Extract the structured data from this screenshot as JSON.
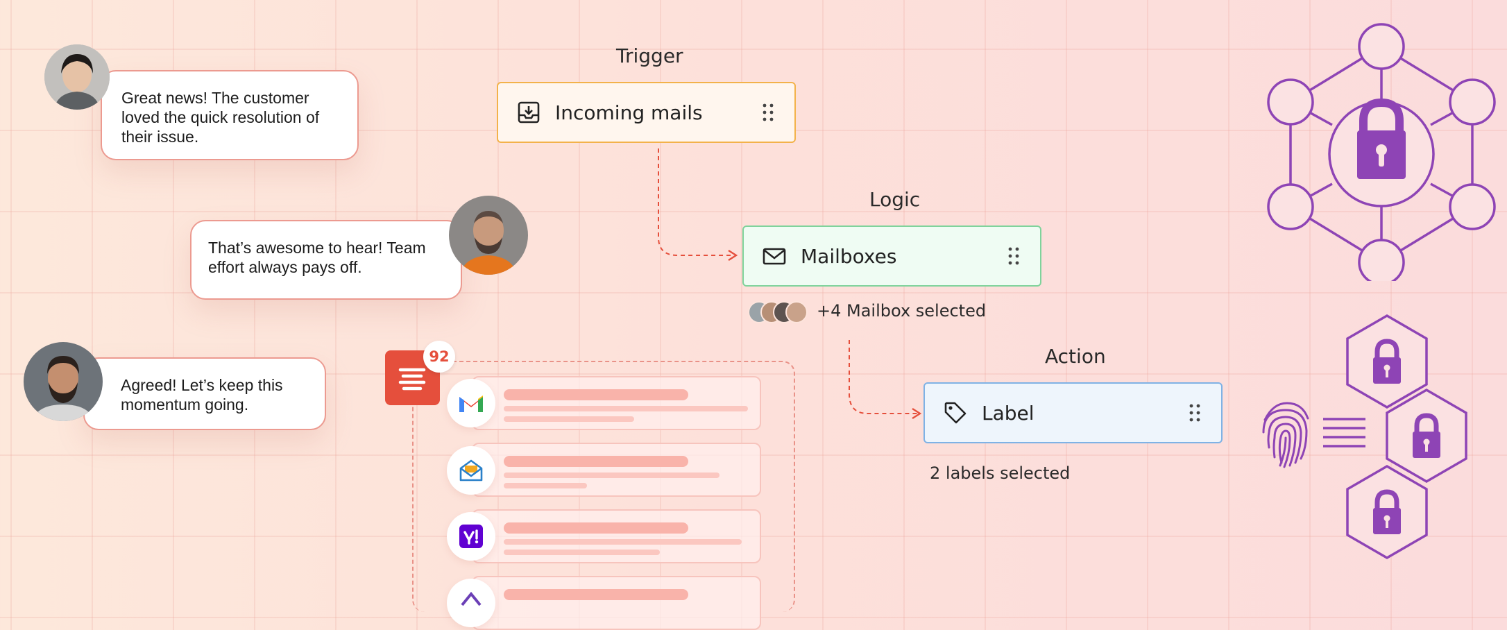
{
  "chat": {
    "messages": [
      {
        "text": "Great news! The customer loved the quick resolution of their issue."
      },
      {
        "text": "That’s awesome to hear! Team effort always pays off."
      },
      {
        "text": "Agreed! Let’s keep this momentum going."
      }
    ]
  },
  "workflow": {
    "trigger": {
      "title": "Trigger",
      "label": "Incoming mails"
    },
    "logic": {
      "title": "Logic",
      "label": "Mailboxes",
      "caption": "+4 Mailbox selected"
    },
    "action": {
      "title": "Action",
      "label": "Label",
      "caption": "2 labels selected"
    }
  },
  "inbox": {
    "badge_count": "92",
    "apps": [
      "gmail-icon",
      "zoho-mail-icon",
      "yahoo-icon",
      "outlook-icon"
    ]
  },
  "colors": {
    "accent_red": "#e54f3c",
    "security_purple": "#8e44b5",
    "trigger_border": "#f3b24a",
    "logic_border": "#7fd39b",
    "action_border": "#7fb2e5"
  }
}
